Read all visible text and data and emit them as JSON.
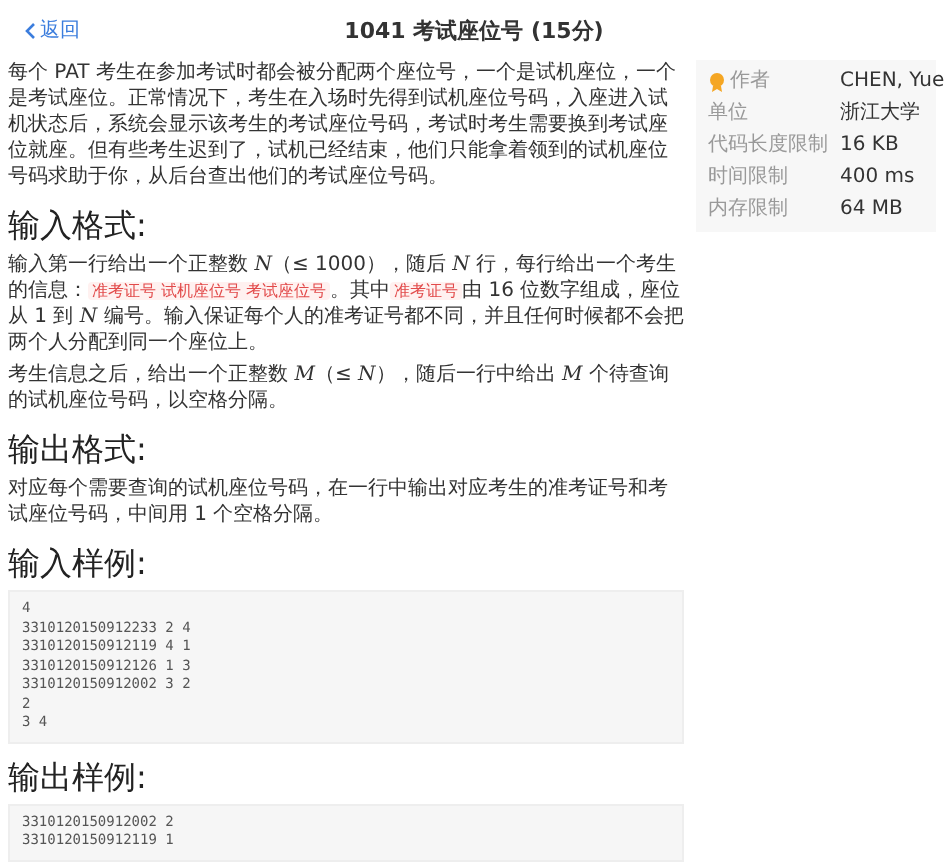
{
  "header": {
    "back": "返回",
    "title": "1041 考试座位号 (15分)"
  },
  "sidebar": [
    {
      "label": "作者",
      "value": "CHEN, Yue",
      "kind": "author"
    },
    {
      "label": "单位",
      "value": "浙江大学"
    },
    {
      "label": "代码长度限制",
      "value": "16 KB"
    },
    {
      "label": "时间限制",
      "value": "400 ms"
    },
    {
      "label": "内存限制",
      "value": "64 MB"
    }
  ],
  "sections": [
    {
      "kind": "text",
      "paragraphs": [
        [
          {
            "kind": "text",
            "text": "每个 PAT 考生在参加考试时都会被分配两个座位号，一个是试机座位，一个是考试座位。正常情况下，考生在入场时先得到试机座位号码，入座进入试机状态后，系统会显示该考生的考试座位号码，考试时考生需要换到考试座位就座。但有些考生迟到了，试机已经结束，他们只能拿着领到的试机座位号码求助于你，从后台查出他们的考试座位号码。"
          }
        ]
      ]
    },
    {
      "kind": "heading",
      "text": "输入格式:"
    },
    {
      "kind": "text",
      "paragraphs": [
        [
          {
            "kind": "text",
            "text": "输入第一行给出一个正整数 "
          },
          {
            "kind": "math",
            "text": "N"
          },
          {
            "kind": "text",
            "text": "（≤ 1000），随后 "
          },
          {
            "kind": "math",
            "text": "N"
          },
          {
            "kind": "text",
            "text": " 行，每行给出一个考生的信息："
          },
          {
            "kind": "code",
            "text": "准考证号 试机座位号 考试座位号"
          },
          {
            "kind": "text",
            "text": "。其中"
          },
          {
            "kind": "code",
            "text": "准考证号"
          },
          {
            "kind": "text",
            "text": "由 16 位数字组成，座位从 1 到 "
          },
          {
            "kind": "math",
            "text": "N"
          },
          {
            "kind": "text",
            "text": " 编号。输入保证每个人的准考证号都不同，并且任何时候都不会把两个人分配到同一个座位上。"
          }
        ],
        [
          {
            "kind": "text",
            "text": "考生信息之后，给出一个正整数 "
          },
          {
            "kind": "math",
            "text": "M"
          },
          {
            "kind": "text",
            "text": "（≤ "
          },
          {
            "kind": "math",
            "text": "N"
          },
          {
            "kind": "text",
            "text": "），随后一行中给出 "
          },
          {
            "kind": "math",
            "text": "M"
          },
          {
            "kind": "text",
            "text": " 个待查询的试机座位号码，以空格分隔。"
          }
        ]
      ]
    },
    {
      "kind": "heading",
      "text": "输出格式:"
    },
    {
      "kind": "text",
      "paragraphs": [
        [
          {
            "kind": "text",
            "text": "对应每个需要查询的试机座位号码，在一行中输出对应考生的准考证号和考试座位号码，中间用 1 个空格分隔。"
          }
        ]
      ]
    },
    {
      "kind": "heading",
      "text": "输入样例:"
    },
    {
      "kind": "code",
      "lines": [
        "4",
        "3310120150912233 2 4",
        "3310120150912119 4 1",
        "3310120150912126 1 3",
        "3310120150912002 3 2",
        "2",
        "3 4"
      ]
    },
    {
      "kind": "heading",
      "text": "输出样例:"
    },
    {
      "kind": "code",
      "lines": [
        "3310120150912002 2",
        "3310120150912119 1"
      ]
    }
  ]
}
